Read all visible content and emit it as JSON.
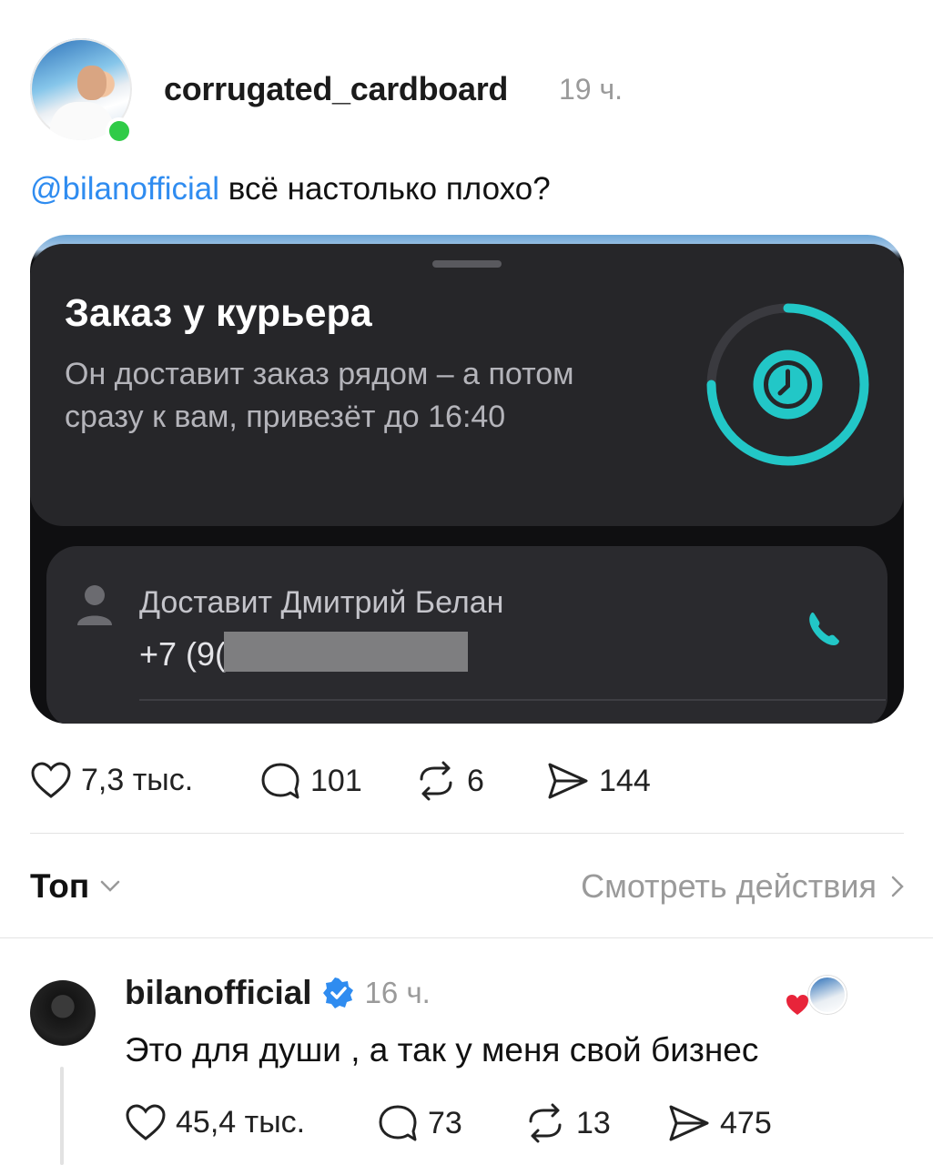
{
  "post": {
    "username": "corrugated_cardboard",
    "time": "19 ч.",
    "mention": "@bilanofficial",
    "text": " всё настолько плохо?",
    "stats": {
      "likes": "7,3 тыс.",
      "comments": "101",
      "reposts": "6",
      "shares": "144"
    }
  },
  "embedded": {
    "title": "Заказ у курьера",
    "subtitle": "Он доставит заказ рядом – а потом сразу к вам, привезёт до 16:40",
    "courier_label": "Доставит Дмитрий Белан",
    "phone_prefix": "+7 (9("
  },
  "feed": {
    "sort_label": "Топ",
    "view_activity": "Смотреть действия"
  },
  "reply": {
    "username": "bilanofficial",
    "time": "16 ч.",
    "text": "Это для души , а так у меня свой бизнес",
    "stats": {
      "likes": "45,4 тыс.",
      "comments": "73",
      "reposts": "13",
      "shares": "475"
    }
  },
  "colors": {
    "accent": "#2f8cf0",
    "online": "#2fcb47",
    "timer": "#22c7c7",
    "verified": "#2f8cf0"
  }
}
